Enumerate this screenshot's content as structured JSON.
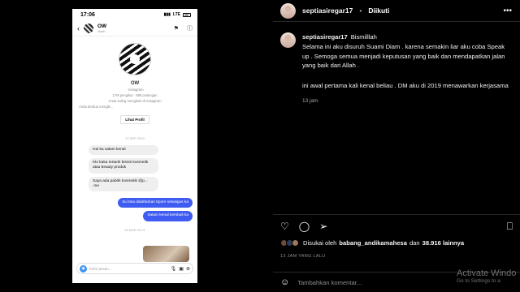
{
  "phone": {
    "time": "17:06",
    "signal": "LTE",
    "chat_title": "OW",
    "chat_sub": "Nadir",
    "profile_name": "OW",
    "profile_line1": "· Instagram",
    "profile_line2": "17M pengikut · 895 postingan",
    "profile_line3": "Anda saling mengikuti di Instagram",
    "profile_line4": "Anda berdua mengik...",
    "profile_button": "Lihat Profil",
    "date1": "22 SEP 2019",
    "date2": "26 MAR 20:21",
    "messages": [
      {
        "dir": "in",
        "text": "Hai ka salam kenal"
      },
      {
        "dir": "in",
        "text": "Klo kaka tertarik bisnis kosmetik atau beauty produk"
      },
      {
        "dir": "in",
        "text": "Saya ada pabrik kosmetik @p...     .me"
      },
      {
        "dir": "out",
        "text": "Itu bisa didaftarkan bpom sekaligus ka"
      },
      {
        "dir": "out",
        "text": "Salam kenal kembali ka"
      }
    ],
    "message_placeholder": "Kirim pesan...",
    "icons": {
      "back": "back-arrow-icon",
      "flag": "flag-icon",
      "info": "info-icon",
      "camera": "camera-icon",
      "mic": "microphone-icon",
      "image": "image-icon",
      "add": "plus-icon"
    }
  },
  "post": {
    "username": "septiasiregar17",
    "separator": "•",
    "follow_label": "Diikuti",
    "caption_user": "septiasiregar17",
    "caption_line1": "Bismilllah",
    "caption_p1": "Selama ini aku disuruh Suami Diam . karena semakin liar aku coba Speak up . Semoga semua menjadi keputusan yang baik dan mendapatkan jalan yang baik dari Allah .",
    "caption_p2": "ini awal pertama kali kenal beliau . DM aku di 2019 menawarkan kerjasama",
    "caption_ago": "13 jam",
    "likes_prefix": "Disukai oleh",
    "likes_user": "babang_andikamahesa",
    "likes_mid": "dan",
    "likes_count": "38.916 lainnya",
    "time_ago": "13 JAM YANG LALU",
    "comment_placeholder": "Tambahkan komentar...",
    "accent_color": "#3e5bf2"
  },
  "watermark": {
    "line1": "Activate Windo",
    "line2": "Go to Settings to a"
  }
}
